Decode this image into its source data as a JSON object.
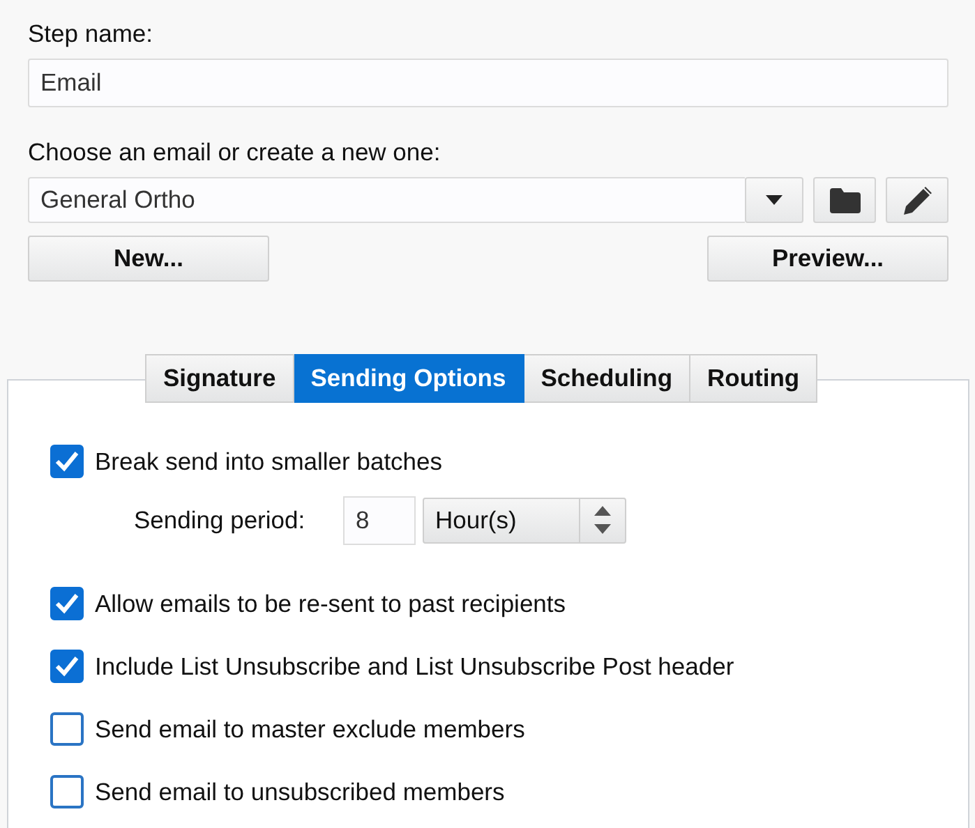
{
  "step_name": {
    "label": "Step name:",
    "value": "Email"
  },
  "email": {
    "label": "Choose an email or create a new one:",
    "value": "General Ortho"
  },
  "buttons": [
    "New...",
    "Preview..."
  ],
  "tabs": [
    {
      "label": "Signature",
      "selected": false
    },
    {
      "label": "Sending Options",
      "selected": true
    },
    {
      "label": "Scheduling",
      "selected": false
    },
    {
      "label": "Routing",
      "selected": false
    }
  ],
  "options": [
    {
      "kind": "checkbox",
      "label": "Break send into smaller batches",
      "checked": true
    },
    {
      "kind": "period",
      "label": "Sending period:",
      "value": "8",
      "unit": "Hour(s)"
    },
    {
      "kind": "checkbox",
      "label": "Allow emails to be re-sent to past recipients",
      "checked": true
    },
    {
      "kind": "checkbox",
      "label": "Include List Unsubscribe and List Unsubscribe Post header",
      "checked": true
    },
    {
      "kind": "checkbox",
      "label": "Send email to master exclude members",
      "checked": false
    },
    {
      "kind": "checkbox",
      "label": "Send email to unsubscribed members",
      "checked": false
    }
  ]
}
